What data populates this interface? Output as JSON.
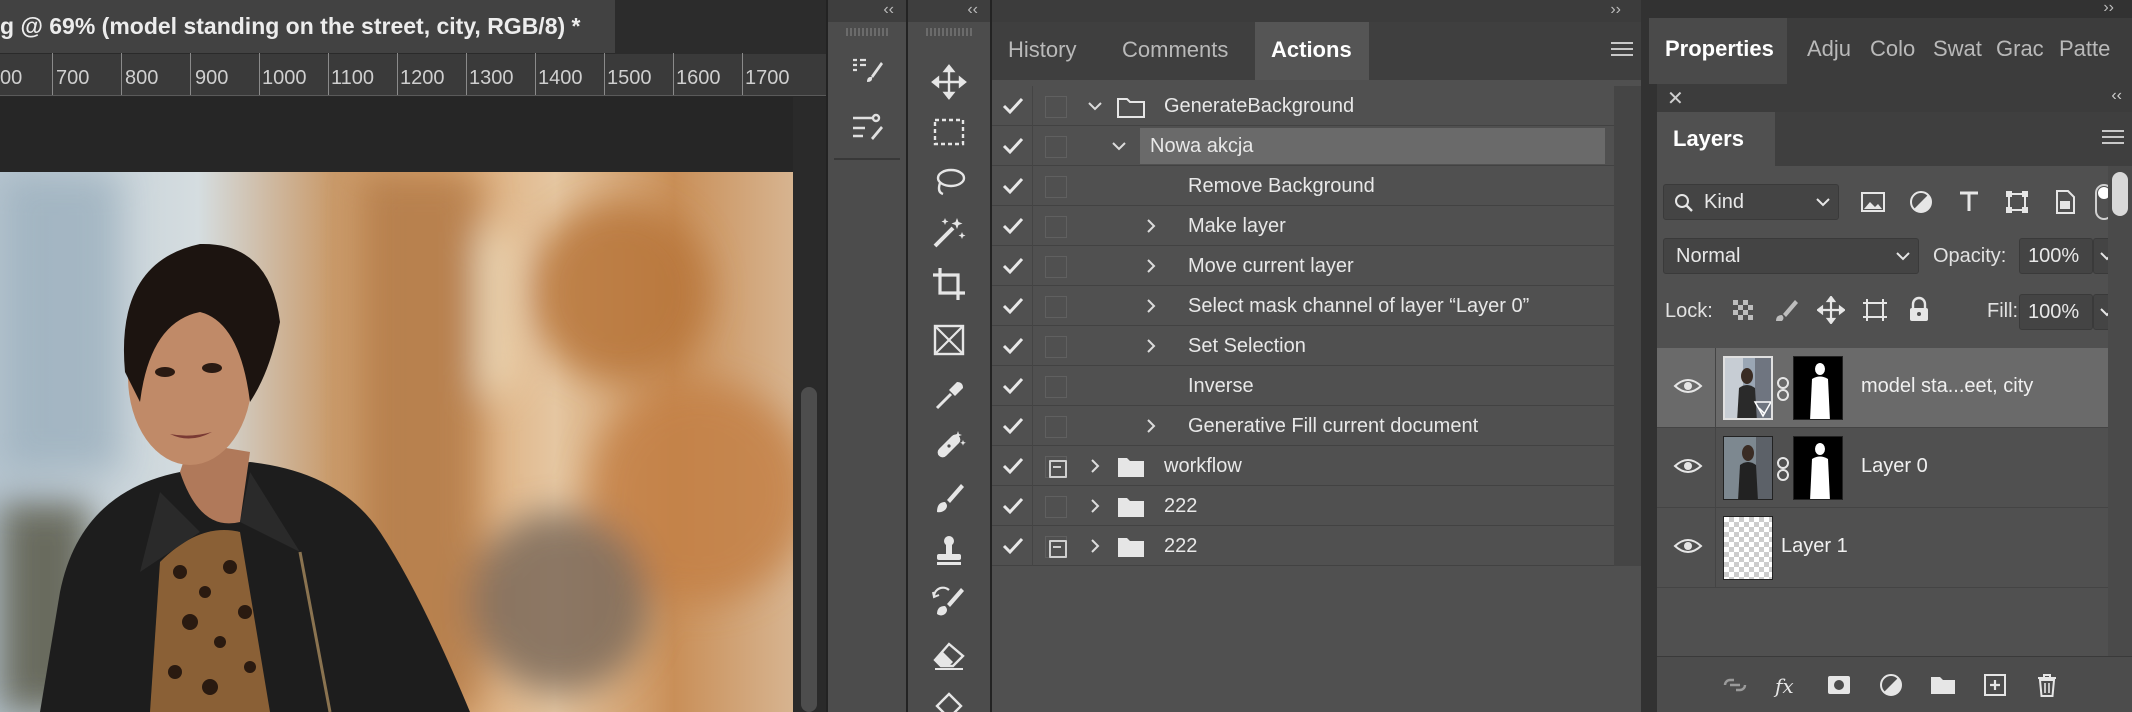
{
  "document": {
    "tab_title": "g @ 69% (model standing on the street, city, RGB/8) *",
    "ruler_labels": [
      "00",
      "700",
      "800",
      "900",
      "1000",
      "1100",
      "1200",
      "1300",
      "1400",
      "1500",
      "1600",
      "1700"
    ]
  },
  "toolbar1": {
    "collapse": "‹‹",
    "tools": [
      "actions-panel-icon",
      "properties-panel-icon"
    ]
  },
  "toolbar2": {
    "collapse": "‹‹",
    "tools": [
      "move-tool-icon",
      "marquee-tool-icon",
      "lasso-tool-icon",
      "magic-wand-tool-icon",
      "crop-tool-icon",
      "frame-tool-icon",
      "eyedropper-tool-icon",
      "healing-brush-tool-icon",
      "brush-tool-icon",
      "clone-stamp-tool-icon",
      "history-brush-tool-icon",
      "eraser-tool-icon",
      "paint-bucket-tool-icon"
    ]
  },
  "actions_panel": {
    "collapse": "››",
    "tabs": [
      {
        "label": "History",
        "active": false
      },
      {
        "label": "Comments",
        "active": false
      },
      {
        "label": "Actions",
        "active": true
      }
    ],
    "rows": [
      {
        "label": "GenerateBackground",
        "type": "set",
        "expanded": true,
        "dialog": false
      },
      {
        "label": "Nowa akcja",
        "type": "action",
        "expanded": true,
        "dialog": false,
        "selected": true
      },
      {
        "label": "Remove Background",
        "type": "step",
        "expandable": false,
        "dialog": false
      },
      {
        "label": "Make layer",
        "type": "step",
        "expandable": true,
        "dialog": false
      },
      {
        "label": "Move current layer",
        "type": "step",
        "expandable": true,
        "dialog": false
      },
      {
        "label": "Select mask channel of layer “Layer 0”",
        "type": "step",
        "expandable": true,
        "dialog": false
      },
      {
        "label": "Set Selection",
        "type": "step",
        "expandable": true,
        "dialog": false
      },
      {
        "label": "Inverse",
        "type": "step",
        "expandable": false,
        "dialog": false
      },
      {
        "label": "Generative Fill current document",
        "type": "step",
        "expandable": true,
        "dialog": false
      },
      {
        "label": "workflow",
        "type": "set",
        "expanded": false,
        "dialog": true
      },
      {
        "label": "222",
        "type": "set",
        "expanded": false,
        "dialog": false
      },
      {
        "label": "222",
        "type": "set",
        "expanded": false,
        "dialog": true
      }
    ]
  },
  "properties": {
    "collapse": "››",
    "tabs": [
      "Properties",
      "Adju",
      "Colo",
      "Swat",
      "Grac",
      "Patte"
    ]
  },
  "layers_panel": {
    "close": "✕",
    "collapse": "‹‹",
    "tab": "Layers",
    "filter_kind": "Kind",
    "blend_mode": "Normal",
    "opacity_label": "Opacity:",
    "opacity_value": "100%",
    "lock_label": "Lock:",
    "fill_label": "Fill:",
    "fill_value": "100%",
    "layers": [
      {
        "name": "model sta...eet, city",
        "selected": true,
        "has_mask": true
      },
      {
        "name": "Layer 0",
        "selected": false,
        "has_mask": true
      },
      {
        "name": "Layer 1",
        "selected": false,
        "has_mask": false
      }
    ]
  },
  "colors": {
    "panel_bg": "#505050",
    "selected_row": "#6a6a6a",
    "tab_bar": "#3f3f3f"
  }
}
